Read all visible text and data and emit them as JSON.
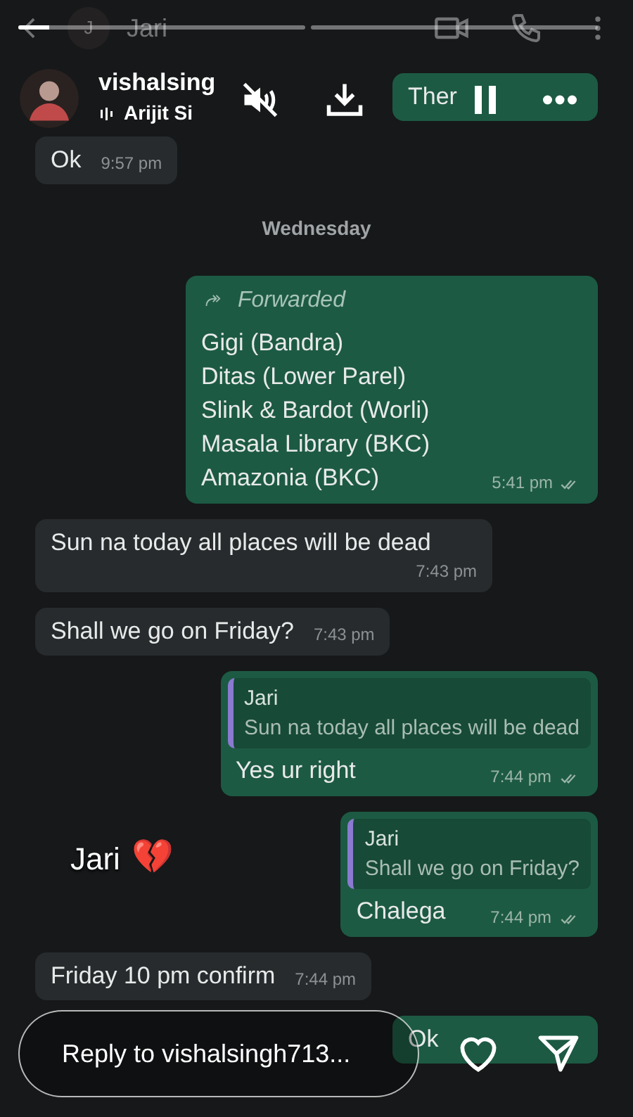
{
  "chat_header": {
    "avatar_letter": "J",
    "title": "Jari"
  },
  "story": {
    "progress": [
      {
        "level": 0.11
      },
      {
        "level": 0
      }
    ],
    "username": "vishalsing",
    "music": "Arijit Si",
    "caption": "Jari",
    "caption_emoji": "💔",
    "reply_placeholder": "Reply to vishalsingh713..."
  },
  "messages": [
    {
      "kind": "text",
      "sent": true,
      "text": "Ther"
    },
    {
      "kind": "text",
      "sent": false,
      "text": "Ok",
      "time": "9:57 pm"
    },
    {
      "kind": "date",
      "text": "Wednesday"
    },
    {
      "kind": "forwarded",
      "sent": true,
      "label": "Forwarded",
      "lines": [
        "Gigi (Bandra)",
        "Ditas (Lower Parel)",
        "Slink & Bardot (Worli)",
        "Masala Library (BKC)",
        "Amazonia (BKC)"
      ],
      "time": "5:41 pm",
      "delivered": true
    },
    {
      "kind": "text",
      "sent": false,
      "text": "Sun na today all places will be dead",
      "time": "7:43 pm"
    },
    {
      "kind": "text",
      "sent": false,
      "text": "Shall we go on Friday?",
      "time": "7:43 pm"
    },
    {
      "kind": "reply",
      "sent": true,
      "quote_author": "Jari",
      "quote_text": "Sun na today all places will be dead",
      "text": "Yes ur right",
      "time": "7:44 pm",
      "delivered": true
    },
    {
      "kind": "reply",
      "sent": true,
      "quote_author": "Jari",
      "quote_text": "Shall we go on Friday?",
      "text": "Chalega",
      "time": "7:44 pm",
      "delivered": true
    },
    {
      "kind": "text",
      "sent": false,
      "text": "Friday 10 pm confirm",
      "time": "7:44 pm"
    },
    {
      "kind": "text",
      "sent": true,
      "text": "Ok"
    }
  ]
}
